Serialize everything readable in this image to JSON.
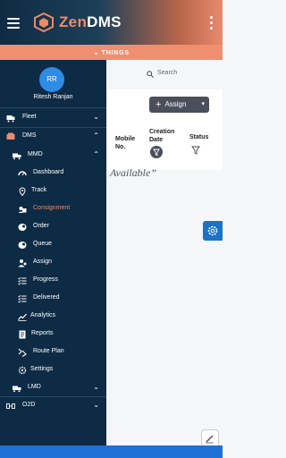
{
  "header": {
    "brand_prefix": "Zen",
    "brand_suffix": "DMS",
    "things_label": "THINGS",
    "things_chevron": "⌄"
  },
  "search": {
    "placeholder": "Search"
  },
  "toolbar": {
    "assign_label": "Assign",
    "assign_dropdown": "▾"
  },
  "table": {
    "columns": [
      "Mobile No.",
      "Creation Date",
      "Status"
    ]
  },
  "empty_text": "Available”",
  "profile": {
    "initials": "RR",
    "name": "Ritesh Ranjan"
  },
  "sidebar": {
    "items": [
      {
        "label": "Fleet",
        "arrow": "⌄"
      },
      {
        "label": "DMS",
        "arrow": "⌃"
      },
      {
        "label": "MMD",
        "arrow": "⌃"
      },
      {
        "label": "Dashboard"
      },
      {
        "label": "Track"
      },
      {
        "label": "Consignment"
      },
      {
        "label": "Order"
      },
      {
        "label": "Queue"
      },
      {
        "label": "Assign"
      },
      {
        "label": "Progress"
      },
      {
        "label": "Delivered"
      },
      {
        "label": "Analytics"
      },
      {
        "label": "Reports"
      },
      {
        "label": "Route Plan"
      },
      {
        "label": "Settings"
      },
      {
        "label": "LMD",
        "arrow": "⌄"
      },
      {
        "label": "O2D",
        "arrow": "⌄"
      }
    ]
  },
  "colors": {
    "accent": "#e98c6f",
    "drawer": "#0d2b45",
    "fab": "#1a72c9"
  }
}
